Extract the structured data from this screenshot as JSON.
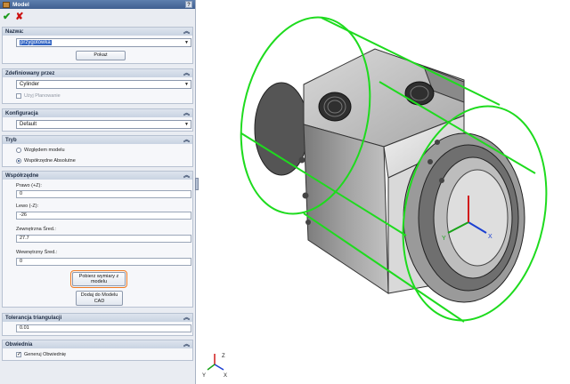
{
  "panel": {
    "title": "Model",
    "help": "?"
  },
  "groups": {
    "nazwa": {
      "header": "Nazwa:",
      "value": "przygotówka",
      "button": "Pokaż"
    },
    "zdefiniowany": {
      "header": "Zdefiniowany przez",
      "value": "Cylinder",
      "checkbox_label": "Użyj Planowanie"
    },
    "konfiguracja": {
      "header": "Konfiguracja",
      "value": "Default"
    },
    "tryb": {
      "header": "Tryb",
      "options": [
        "Względem modelu",
        "Współrzędne Absolutne"
      ],
      "selected_index": 1
    },
    "wspolrzedne": {
      "header": "Współrzędne",
      "fields": [
        {
          "label": "Prawo (+Z):",
          "value": "0"
        },
        {
          "label": "Lewo (-Z):",
          "value": "-26"
        },
        {
          "label": "Zewnętrzna Śred.:",
          "value": "27.7"
        },
        {
          "label": "Wewnętrzny Śred.:",
          "value": "0"
        }
      ],
      "button_get": "Pobierz wymiary z modelu",
      "button_add": "Dodaj do Modelu CAD"
    },
    "tolerancja": {
      "header": "Tolerancja triangulacji",
      "value": "0.01"
    },
    "obwiednia": {
      "header": "Obwiednia",
      "checkbox_label": "Generuj Obwiednię",
      "checked": true
    }
  },
  "triad": {
    "x": "X",
    "y": "Y",
    "z": "Z"
  },
  "colors": {
    "bounding_cylinder": "#1edb1e",
    "axis_x": "#1b3fd1",
    "axis_y": "#19a319",
    "axis_z": "#d11b1b",
    "highlight": "#f07a22"
  }
}
